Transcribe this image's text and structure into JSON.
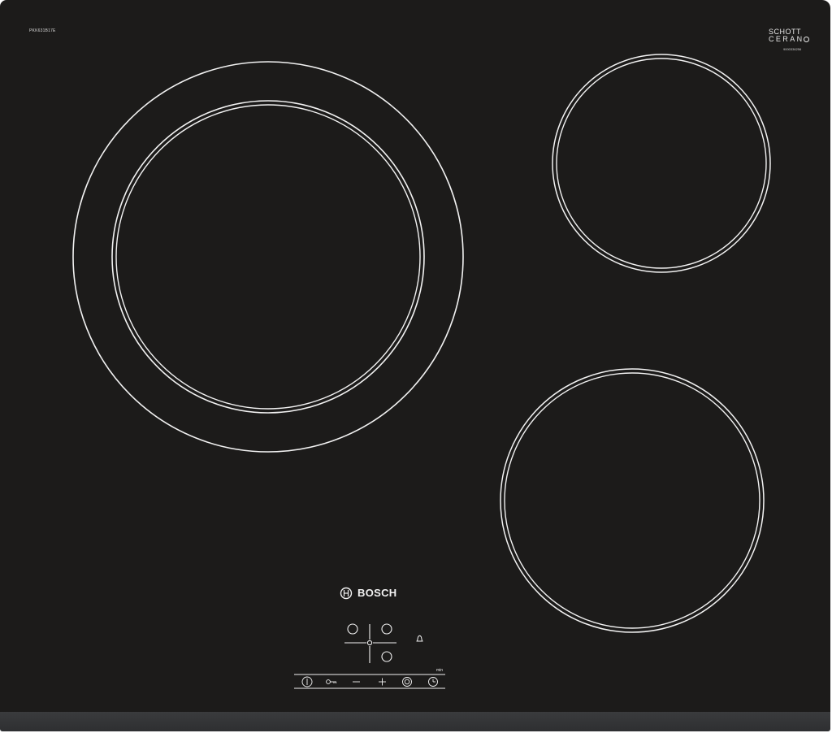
{
  "product": {
    "model_code": "PKK631B17E",
    "brand": "BOSCH",
    "glass_brand_line1": "SCHOTT",
    "glass_brand_line2": "CERAN",
    "glass_code": "9000336256"
  },
  "controls": {
    "timer_unit_label": "min",
    "buttons": [
      {
        "icon": "power-icon"
      },
      {
        "icon": "key-lock-icon"
      },
      {
        "icon": "minus-icon"
      },
      {
        "icon": "plus-icon"
      },
      {
        "icon": "dual-zone-icon"
      },
      {
        "icon": "timer-clock-icon"
      }
    ]
  },
  "cooking_zones": [
    {
      "name": "dual-zone-front-left",
      "rings": 2
    },
    {
      "name": "zone-rear-right",
      "rings": 1
    },
    {
      "name": "zone-front-right",
      "rings": 1
    }
  ],
  "colors": {
    "glass": "#1c1b1a",
    "edge": "#333436",
    "print": "#f2f2f2"
  }
}
